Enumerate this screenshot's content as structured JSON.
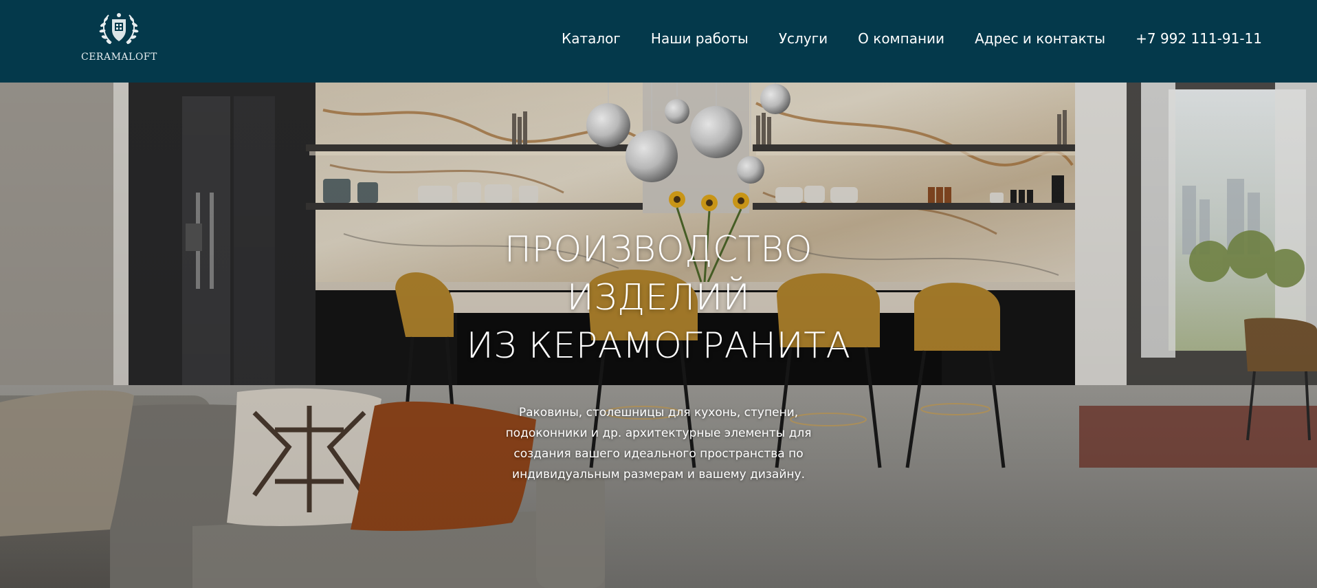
{
  "header": {
    "logo_text": "CERAMALOFT",
    "nav": [
      {
        "label": "Каталог"
      },
      {
        "label": "Наши работы"
      },
      {
        "label": "Услуги"
      },
      {
        "label": "О компании"
      },
      {
        "label": "Адрес и контакты"
      }
    ],
    "phone": "+7 992 111-91-11"
  },
  "hero": {
    "title_lines": [
      "ПРОИЗВОДСТВО",
      "ИЗДЕЛИЙ",
      "ИЗ КЕРАМОГРАНИТА"
    ],
    "subtitle_lines": [
      "Раковины, столешницы для кухонь, ступени,",
      "подоконники и др. архитектурные элементы для",
      "создания вашего идеального пространства по",
      "индивидуальным размерам и вашему дизайну."
    ]
  },
  "colors": {
    "header_bg": "#04394b",
    "text": "#ffffff",
    "chair_mustard": "#b8892e",
    "pillow_rust": "#9a4a1c",
    "floor_grey": "#8d8c88"
  },
  "icons": {
    "logo": "laurel-wreath-crest-icon"
  }
}
